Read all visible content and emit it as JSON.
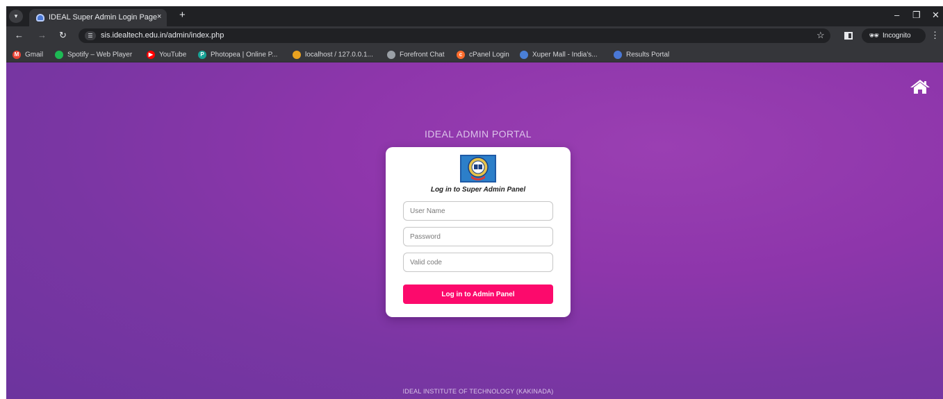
{
  "browser": {
    "tab_title": "IDEAL Super Admin Login Page",
    "tab_close": "×",
    "new_tab": "+",
    "url": "sis.idealtech.edu.in/admin/index.php",
    "incognito_label": "Incognito",
    "window_controls": {
      "minimize": "–",
      "restore": "❐",
      "close": "✕"
    }
  },
  "bookmarks": [
    {
      "label": "Gmail",
      "color": "#ea4335",
      "icon": "gmail-icon",
      "glyph": "M"
    },
    {
      "label": "Spotify – Web Player",
      "color": "#1db954",
      "icon": "spotify-icon",
      "glyph": ""
    },
    {
      "label": "YouTube",
      "color": "#ff0000",
      "icon": "youtube-icon",
      "glyph": "▶"
    },
    {
      "label": "Photopea | Online P...",
      "color": "#18a497",
      "icon": "photopea-icon",
      "glyph": "P"
    },
    {
      "label": "localhost / 127.0.0.1...",
      "color": "#e9a21f",
      "icon": "phpmyadmin-icon",
      "glyph": ""
    },
    {
      "label": "Forefront Chat",
      "color": "#9aa0a6",
      "icon": "forefront-icon",
      "glyph": ""
    },
    {
      "label": "cPanel Login",
      "color": "#ff6c2c",
      "icon": "cpanel-icon",
      "glyph": "c"
    },
    {
      "label": "Xuper Mall - India's...",
      "color": "#4a7fd6",
      "icon": "xupermall-icon",
      "glyph": ""
    },
    {
      "label": "Results Portal",
      "color": "#4a78d6",
      "icon": "results-portal-icon",
      "glyph": ""
    }
  ],
  "page": {
    "portal_title": "IDEAL ADMIN PORTAL",
    "heading": "Log in to Super Admin Panel",
    "username_placeholder": "User Name",
    "password_placeholder": "Password",
    "code_placeholder": "Valid code",
    "submit_label": "Log in to Admin Panel",
    "footer": "IDEAL INSTITUTE OF TECHNOLOGY (KAKINADA)"
  },
  "colors": {
    "background_purple": "#8e36ab",
    "button_pink": "#fc0a6c",
    "browser_dark": "#202124",
    "browser_toolbar": "#35363a"
  }
}
